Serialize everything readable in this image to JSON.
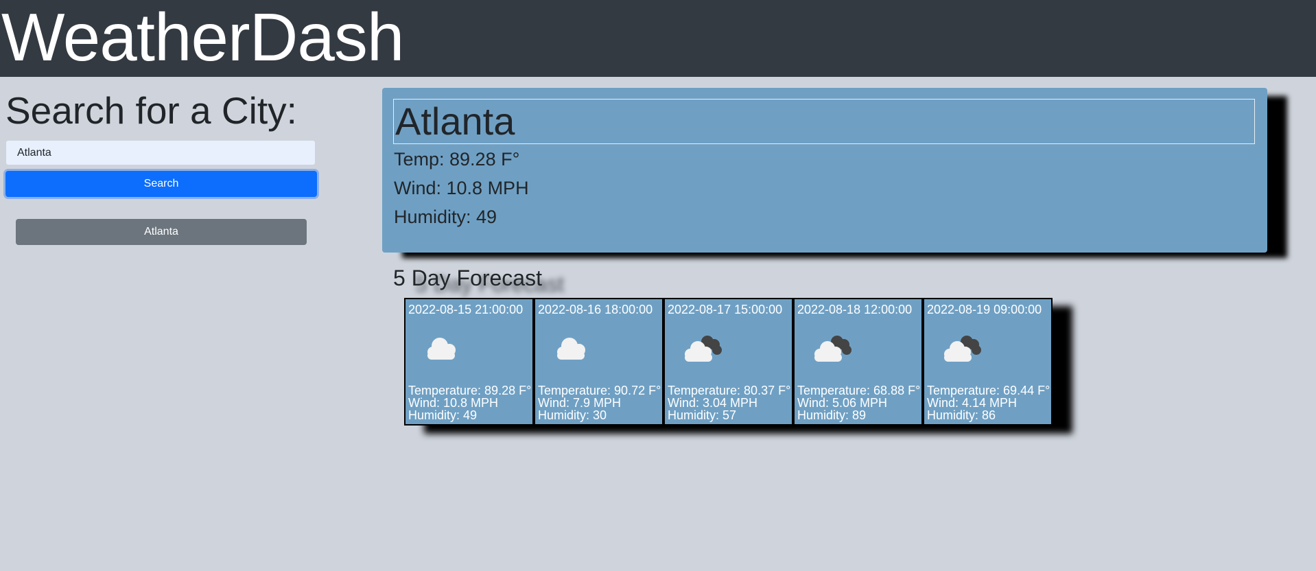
{
  "header": {
    "brand": "WeatherDash"
  },
  "sidebar": {
    "title": "Search for a City:",
    "search_value": "Atlanta",
    "search_label": "Search",
    "history": [
      "Atlanta"
    ]
  },
  "current": {
    "city": "Atlanta",
    "temp": "Temp: 89.28 F°",
    "wind": "Wind: 10.8 MPH",
    "humidity": "Humidity: 49"
  },
  "forecast": {
    "title": "5 Day Forecast",
    "days": [
      {
        "date": "2022-08-15 21:00:00",
        "icon": "cloud-icon",
        "temp": "Temperature: 89.28 F°",
        "wind": "Wind: 10.8 MPH",
        "humidity": "Humidity: 49"
      },
      {
        "date": "2022-08-16 18:00:00",
        "icon": "cloud-icon",
        "temp": "Temperature: 90.72 F°",
        "wind": "Wind: 7.9 MPH",
        "humidity": "Humidity: 30"
      },
      {
        "date": "2022-08-17 15:00:00",
        "icon": "broken-clouds-icon",
        "temp": "Temperature: 80.37 F°",
        "wind": "Wind: 3.04 MPH",
        "humidity": "Humidity: 57"
      },
      {
        "date": "2022-08-18 12:00:00",
        "icon": "broken-clouds-icon",
        "temp": "Temperature: 68.88 F°",
        "wind": "Wind: 5.06 MPH",
        "humidity": "Humidity: 89"
      },
      {
        "date": "2022-08-19 09:00:00",
        "icon": "broken-clouds-icon",
        "temp": "Temperature: 69.44 F°",
        "wind": "Wind: 4.14 MPH",
        "humidity": "Humidity: 86"
      }
    ]
  },
  "colors": {
    "header_bg": "#343a42",
    "page_bg": "#cfd4dc",
    "card_bg": "#6fa0c4",
    "primary": "#0d6efd",
    "secondary": "#6c757d"
  }
}
